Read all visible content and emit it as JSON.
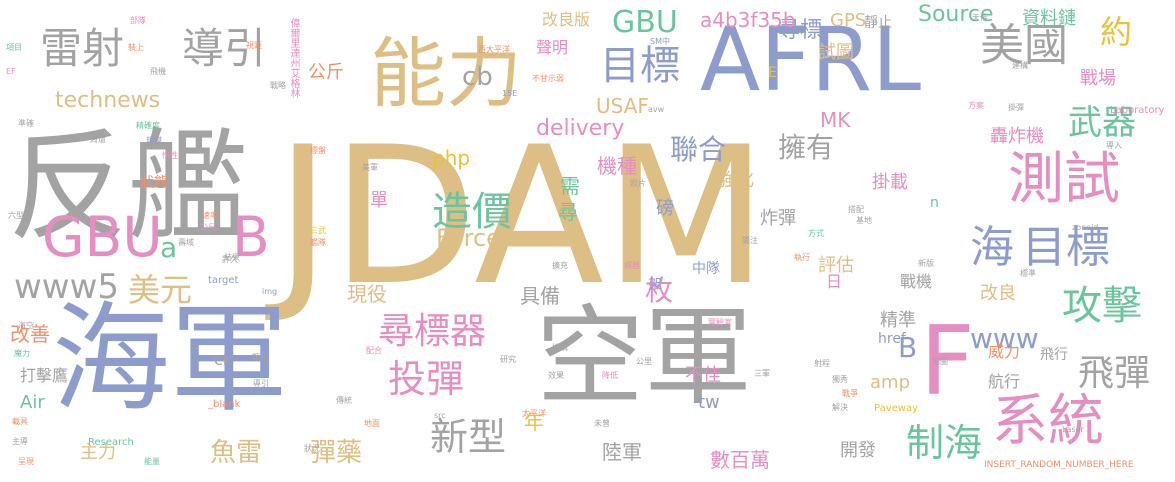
{
  "colors": {
    "gray": "#a3a3a3",
    "tan": "#ddbf86",
    "blue": "#8e9ccb",
    "green": "#6cc49e",
    "pink": "#e48ec1",
    "orange": "#ef906a",
    "lime": "#a7cd5a",
    "yellow": "#e8c23a",
    "olive": "#b9b88a"
  },
  "words": [
    {
      "text": "JDAM",
      "color": "tan"
    },
    {
      "text": "反艦",
      "color": "gray"
    },
    {
      "text": "海軍",
      "color": "blue"
    },
    {
      "text": "空軍",
      "color": "gray"
    },
    {
      "text": "AFRL",
      "color": "blue"
    },
    {
      "text": "能力",
      "color": "tan"
    },
    {
      "text": "F",
      "color": "pink"
    },
    {
      "text": "GBU",
      "color": "pink"
    },
    {
      "text": "B",
      "color": "pink"
    },
    {
      "text": "雷射",
      "color": "gray"
    },
    {
      "text": "導引",
      "color": "gray"
    },
    {
      "text": "測試",
      "color": "pink"
    },
    {
      "text": "系統",
      "color": "pink"
    },
    {
      "text": "目標",
      "color": "blue"
    },
    {
      "text": "海",
      "color": "blue"
    },
    {
      "text": "美國",
      "color": "gray"
    },
    {
      "text": "目標",
      "color": "blue"
    },
    {
      "text": "造價",
      "color": "green"
    },
    {
      "text": "尋標器",
      "color": "pink"
    },
    {
      "text": "攻擊",
      "color": "green"
    },
    {
      "text": "投彈",
      "color": "pink"
    },
    {
      "text": "武器",
      "color": "green"
    },
    {
      "text": "新型",
      "color": "gray"
    },
    {
      "text": "制海",
      "color": "green"
    },
    {
      "text": "飛彈",
      "color": "gray"
    },
    {
      "text": "www5",
      "color": "gray"
    },
    {
      "text": "美元",
      "color": "tan"
    },
    {
      "text": "GBU",
      "color": "green"
    },
    {
      "text": "約",
      "color": "yellow"
    },
    {
      "text": "cb",
      "color": "gray"
    },
    {
      "text": "聯合",
      "color": "blue"
    },
    {
      "text": "擁有",
      "color": "gray"
    },
    {
      "text": "枚",
      "color": "pink"
    },
    {
      "text": "a",
      "color": "green"
    },
    {
      "text": "魚雷",
      "color": "tan"
    },
    {
      "text": "彈藥",
      "color": "tan"
    },
    {
      "text": "Force",
      "color": "tan"
    },
    {
      "text": "www",
      "color": "blue"
    },
    {
      "text": "B",
      "color": "blue"
    },
    {
      "text": "technews",
      "color": "tan"
    },
    {
      "text": "delivery",
      "color": "pink"
    },
    {
      "text": "Source",
      "color": "green"
    },
    {
      "text": "尋標",
      "color": "blue"
    },
    {
      "text": "機種",
      "color": "pink"
    },
    {
      "text": "php",
      "color": "yellow"
    },
    {
      "text": "MK",
      "color": "pink"
    },
    {
      "text": "a4b3f35b",
      "color": "pink"
    },
    {
      "text": "GPS",
      "color": "tan"
    },
    {
      "text": "USAF",
      "color": "tan"
    },
    {
      "text": "資料鏈",
      "color": "green"
    },
    {
      "text": "公斤",
      "color": "orange"
    },
    {
      "text": "試圖",
      "color": "tan"
    },
    {
      "text": "戰場",
      "color": "pink"
    },
    {
      "text": "轟炸機",
      "color": "pink"
    },
    {
      "text": "掛載",
      "color": "pink"
    },
    {
      "text": "強化",
      "color": "tan"
    },
    {
      "text": "炸彈",
      "color": "gray"
    },
    {
      "text": "改善",
      "color": "orange"
    },
    {
      "text": "現役",
      "color": "tan"
    },
    {
      "text": "具備",
      "color": "gray"
    },
    {
      "text": "精準",
      "color": "gray"
    },
    {
      "text": "改良",
      "color": "tan"
    },
    {
      "text": "評估",
      "color": "tan"
    },
    {
      "text": "年",
      "color": "yellow"
    },
    {
      "text": "陸軍",
      "color": "gray"
    },
    {
      "text": "數百萬",
      "color": "pink"
    },
    {
      "text": "開發",
      "color": "gray"
    },
    {
      "text": "主力",
      "color": "tan"
    },
    {
      "text": "打擊鷹",
      "color": "gray"
    },
    {
      "text": "Air",
      "color": "green"
    },
    {
      "text": "不佳",
      "color": "pink"
    },
    {
      "text": "tw",
      "color": "blue"
    },
    {
      "text": "amp",
      "color": "tan"
    },
    {
      "text": "航行",
      "color": "gray"
    },
    {
      "text": "戰機",
      "color": "gray"
    },
    {
      "text": "威力",
      "color": "orange"
    },
    {
      "text": "改良版",
      "color": "tan"
    },
    {
      "text": "聲明",
      "color": "pink"
    },
    {
      "text": "靜止",
      "color": "gray"
    },
    {
      "text": "飛行",
      "color": "gray"
    },
    {
      "text": "狀態",
      "color": "orange"
    },
    {
      "text": "需",
      "color": "green"
    },
    {
      "text": "尋",
      "color": "green"
    },
    {
      "text": "單",
      "color": "pink"
    },
    {
      "text": "磅",
      "color": "blue"
    },
    {
      "text": "日",
      "color": "pink"
    },
    {
      "text": "中隊",
      "color": "blue"
    },
    {
      "text": "架",
      "color": "blue"
    },
    {
      "text": "ck",
      "color": "gray"
    },
    {
      "text": "href",
      "color": "blue"
    },
    {
      "text": "E",
      "color": "yellow"
    },
    {
      "text": "n",
      "color": "green"
    },
    {
      "text": "偉爾里達州艾格林",
      "color": "pink"
    },
    {
      "text": "西大平洋",
      "color": "orange"
    },
    {
      "text": "不甘示弱",
      "color": "orange"
    },
    {
      "text": "INSERT_RANDOM_NUMBER_HERE",
      "color": "orange"
    },
    {
      "text": "Laboratory",
      "color": "pink"
    },
    {
      "text": "Research",
      "color": "green"
    },
    {
      "text": "Paveway",
      "color": "yellow"
    },
    {
      "text": "target",
      "color": "blue"
    },
    {
      "text": "zoneid",
      "color": "gray"
    },
    {
      "text": "Laser",
      "color": "gray"
    },
    {
      "text": "_blank",
      "color": "orange"
    },
    {
      "text": "img",
      "color": "blue"
    },
    {
      "text": "src",
      "color": "gray"
    },
    {
      "text": "avw",
      "color": "gray"
    },
    {
      "text": "SM中",
      "color": "blue"
    },
    {
      "text": "15E",
      "color": "blue"
    },
    {
      "text": "EF",
      "color": "pink"
    },
    {
      "text": "項目",
      "color": "green"
    },
    {
      "text": "裝上",
      "color": "orange"
    },
    {
      "text": "部隊",
      "color": "pink"
    },
    {
      "text": "視距",
      "color": "orange"
    },
    {
      "text": "飛機",
      "color": "gray"
    },
    {
      "text": "戰略",
      "color": "gray"
    },
    {
      "text": "準確",
      "color": "gray"
    },
    {
      "text": "周遭",
      "color": "gray"
    },
    {
      "text": "精確度",
      "color": "green"
    },
    {
      "text": "規模",
      "color": "blue"
    },
    {
      "text": "惰性",
      "color": "pink"
    },
    {
      "text": "標盤",
      "color": "orange"
    },
    {
      "text": "美軍",
      "color": "gray"
    },
    {
      "text": "照片",
      "color": "gray"
    },
    {
      "text": "搭配",
      "color": "gray"
    },
    {
      "text": "基地",
      "color": "gray"
    },
    {
      "text": "六型",
      "color": "gray"
    },
    {
      "text": "速率",
      "color": "orange"
    },
    {
      "text": "公尺",
      "color": "pink"
    },
    {
      "text": "三武",
      "color": "yellow"
    },
    {
      "text": "艦隊",
      "color": "orange"
    },
    {
      "text": "壽域",
      "color": "gray"
    },
    {
      "text": "許久",
      "color": "gray"
    },
    {
      "text": "結果",
      "color": "gray"
    },
    {
      "text": "擴充",
      "color": "gray"
    },
    {
      "text": "標器",
      "color": "pink"
    },
    {
      "text": "關注",
      "color": "gray"
    },
    {
      "text": "方式",
      "color": "green"
    },
    {
      "text": "執行",
      "color": "orange"
    },
    {
      "text": "新版",
      "color": "gray"
    },
    {
      "text": "標準",
      "color": "gray"
    },
    {
      "text": "海空",
      "color": "gray"
    },
    {
      "text": "魔力",
      "color": "green"
    },
    {
      "text": "配合",
      "color": "pink"
    },
    {
      "text": "採購",
      "color": "gray"
    },
    {
      "text": "研究",
      "color": "gray"
    },
    {
      "text": "類型",
      "color": "gray"
    },
    {
      "text": "導引",
      "color": "gray"
    },
    {
      "text": "傳統",
      "color": "gray"
    },
    {
      "text": "載具",
      "color": "orange"
    },
    {
      "text": "主導",
      "color": "gray"
    },
    {
      "text": "呈現",
      "color": "orange"
    },
    {
      "text": "能量",
      "color": "green"
    },
    {
      "text": "狀況",
      "color": "gray"
    },
    {
      "text": "地面",
      "color": "orange"
    },
    {
      "text": "太平洋",
      "color": "orange"
    },
    {
      "text": "未曾",
      "color": "gray"
    },
    {
      "text": "公里",
      "color": "gray"
    },
    {
      "text": "效果",
      "color": "gray"
    },
    {
      "text": "降低",
      "color": "pink"
    },
    {
      "text": "實驗室",
      "color": "pink"
    },
    {
      "text": "三軍",
      "color": "gray"
    },
    {
      "text": "射程",
      "color": "gray"
    },
    {
      "text": "獨秀",
      "color": "gray"
    },
    {
      "text": "戰爭",
      "color": "orange"
    },
    {
      "text": "解決",
      "color": "gray"
    },
    {
      "text": "地圖",
      "color": "gray"
    },
    {
      "text": "方案",
      "color": "pink"
    },
    {
      "text": "掛彈",
      "color": "gray"
    },
    {
      "text": "建構",
      "color": "gray"
    },
    {
      "text": "天候",
      "color": "gray"
    },
    {
      "text": "導入",
      "color": "gray"
    },
    {
      "text": "大國",
      "color": "gray"
    },
    {
      "text": "Ⅲ",
      "color": "gray"
    }
  ]
}
